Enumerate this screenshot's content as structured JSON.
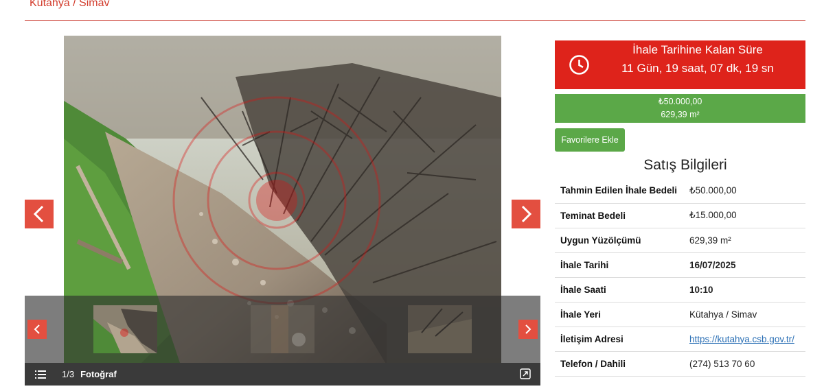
{
  "location_title": "Kütahya / Simav",
  "gallery": {
    "counter": "1/3",
    "photo_label": "Fotoğraf",
    "thumbnail_count": 3,
    "active_index": 1
  },
  "countdown": {
    "label": "İhale Tarihine Kalan Süre",
    "value": "11 Gün, 19 saat, 07 dk, 19 sn",
    "color": "#de231b"
  },
  "price_box": {
    "price": "₺50.000,00",
    "area": "629,39 m²",
    "color": "#5ba848"
  },
  "favorite_button": {
    "label": "Favorilere Ekle"
  },
  "sale_info": {
    "heading": "Satış Bilgileri",
    "rows": [
      {
        "label": "Tahmin Edilen İhale Bedeli",
        "value": "₺50.000,00"
      },
      {
        "label": "Teminat Bedeli",
        "value": "₺15.000,00"
      },
      {
        "label": "Uygun Yüzölçümü",
        "value": "629,39 m²"
      },
      {
        "label": "İhale Tarihi",
        "value": "16/07/2025"
      },
      {
        "label": "İhale Saati",
        "value": "10:10"
      },
      {
        "label": "İhale Yeri",
        "value": "Kütahya / Simav"
      },
      {
        "label": "İletişim Adresi",
        "value": "https://kutahya.csb.gov.tr/"
      },
      {
        "label": "Telefon / Dahili",
        "value": "(274) 513 70 60"
      }
    ]
  },
  "icons": {
    "clock": "clock-icon",
    "list": "list-icon",
    "expand": "expand-icon",
    "prev": "chevron-left-icon",
    "next": "chevron-right-icon"
  }
}
